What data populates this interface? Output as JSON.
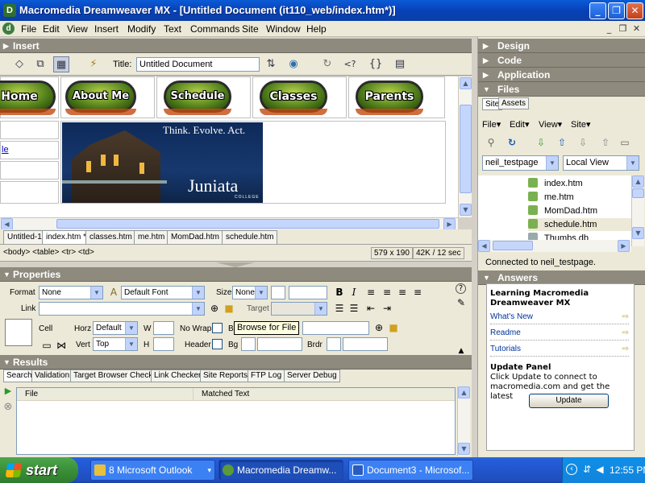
{
  "window": {
    "title": "Macromedia Dreamweaver MX - [Untitled Document (it110_web/index.htm*)]",
    "minimize": "_",
    "maximize": "❐",
    "close": "✕"
  },
  "menubar": {
    "logo": "d",
    "items": [
      "File",
      "Edit",
      "View",
      "Insert",
      "Modify",
      "Text",
      "Commands",
      "Site",
      "Window",
      "Help"
    ],
    "mdi_min": "_",
    "mdi_restore": "❐",
    "mdi_close": "✕"
  },
  "insert_panel": {
    "label": "Insert"
  },
  "doc_toolbar": {
    "title_label": "Title:",
    "title_value": "Untitled Document"
  },
  "design": {
    "nav_buttons": [
      "Home",
      "About Me",
      "Schedule",
      "Classes",
      "Parents"
    ],
    "left_link": "le",
    "banner": {
      "tagline": "Think. Evolve. Act.",
      "brand": "Juniata",
      "brand_sub": "COLLEGE"
    }
  },
  "doc_tabs": [
    "Untitled-1",
    "index.htm *",
    "classes.htm",
    "me.htm",
    "MomDad.htm",
    "schedule.htm"
  ],
  "status_bar": {
    "tag_path": "<body> <table> <tr> <td>",
    "dimensions": "579 x 190",
    "download": "42K / 12 sec"
  },
  "properties": {
    "header": "Properties",
    "format_label": "Format",
    "format_value": "None",
    "font_value": "Default Font",
    "size_label": "Size",
    "size_value": "None",
    "link_label": "Link",
    "target_label": "Target",
    "cell_label": "Cell",
    "horz_label": "Horz",
    "horz_value": "Default",
    "vert_label": "Vert",
    "vert_value": "Top",
    "w_label": "W",
    "h_label": "H",
    "nowrap_label": "No Wrap",
    "header_label": "Header",
    "bg_label": "Bg",
    "bg2_label": "Bg",
    "brdr_label": "Brdr",
    "tooltip": "Browse for File",
    "bold": "B",
    "italic": "I"
  },
  "results": {
    "header": "Results",
    "tabs": [
      "Search",
      "Validation",
      "Target Browser Check",
      "Link Checker",
      "Site Reports",
      "FTP Log",
      "Server Debug"
    ],
    "columns": [
      "File",
      "Matched Text"
    ]
  },
  "right_panel": {
    "design_label": "Design",
    "code_label": "Code",
    "application_label": "Application",
    "files_label": "Files",
    "files_tabs": [
      "Site",
      "Assets"
    ],
    "files_menus": [
      "File",
      "Edit",
      "View",
      "Site"
    ],
    "site_value": "neil_testpage",
    "view_value": "Local View",
    "files": [
      "index.htm",
      "me.htm",
      "MomDad.htm",
      "schedule.htm",
      "Thumbs.db"
    ],
    "connection_status": "Connected to neil_testpage.",
    "answers_label": "Answers"
  },
  "answers": {
    "heading": "Learning Macromedia Dreamweaver MX",
    "links": [
      "What's New",
      "Readme",
      "Tutorials"
    ],
    "update_heading": "Update Panel",
    "update_text": "Click Update to connect to macromedia.com and get the latest",
    "update_button": "Update"
  },
  "taskbar": {
    "start_label": "start",
    "tasks": [
      "8 Microsoft Outlook",
      "Macromedia Dreamw...",
      "Document3 - Microsof..."
    ],
    "clock": "12:55 PM"
  }
}
